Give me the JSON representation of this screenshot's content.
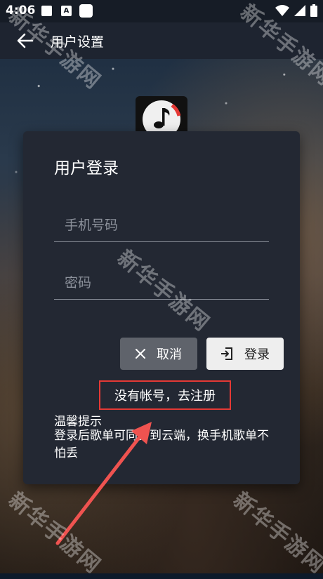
{
  "status_bar": {
    "time": "4:06",
    "notification_a": "A"
  },
  "app_bar": {
    "title": "用户设置",
    "back_icon": "arrow-left-icon"
  },
  "dialog": {
    "title": "用户登录",
    "phone_placeholder": "手机号码",
    "password_placeholder": "密码",
    "cancel_label": "取消",
    "login_label": "登录",
    "register_link": "没有帐号，去注册",
    "tip_title": "温馨提示",
    "tip_body": "登录后歌单可同步到云端，换手机歌单不怕丢"
  },
  "watermark": "新华手游网",
  "colors": {
    "dialog_bg": "#232833",
    "cancel_bg": "#5f636b",
    "login_bg": "#eeeeee",
    "highlight": "#e53935"
  }
}
